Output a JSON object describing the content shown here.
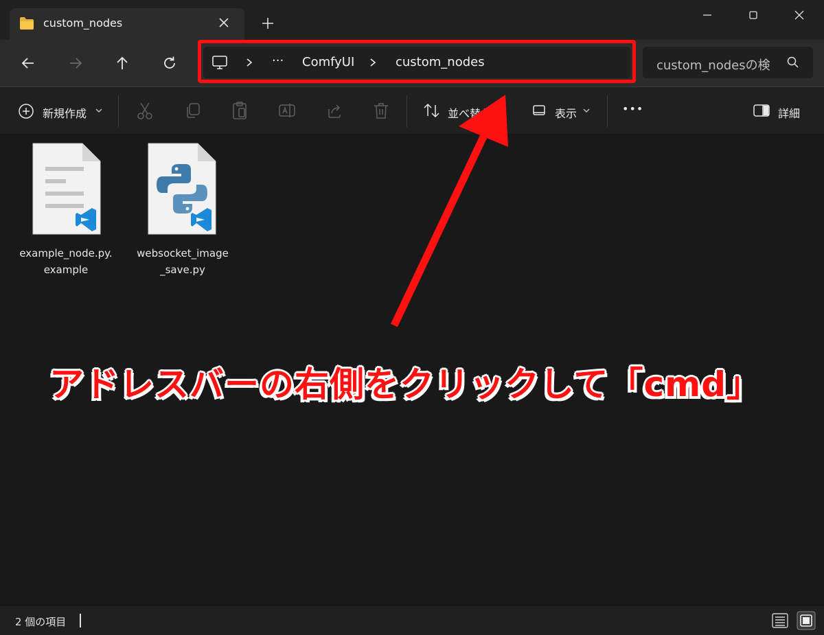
{
  "window": {
    "tab_title": "custom_nodes"
  },
  "address_bar": {
    "segments": [
      "ComfyUI",
      "custom_nodes"
    ],
    "overflow": "···"
  },
  "search": {
    "placeholder": "custom_nodesの検"
  },
  "toolbar": {
    "new_label": "新規作成",
    "sort_label": "並べ替え",
    "view_label": "表示",
    "more_label": "•••",
    "details_label": "詳細"
  },
  "files": [
    {
      "name": "example_node.py.example",
      "icon": "text-file-vscode-icon"
    },
    {
      "name": "websocket_image_save.py",
      "icon": "python-file-vscode-icon"
    }
  ],
  "status": {
    "item_count": "2 個の項目"
  },
  "annotation": {
    "text": "アドレスバーの右側をクリックして「cmd」",
    "color": "#ff1111"
  },
  "colors": {
    "highlight": "#ff1010",
    "background": "#191919"
  }
}
